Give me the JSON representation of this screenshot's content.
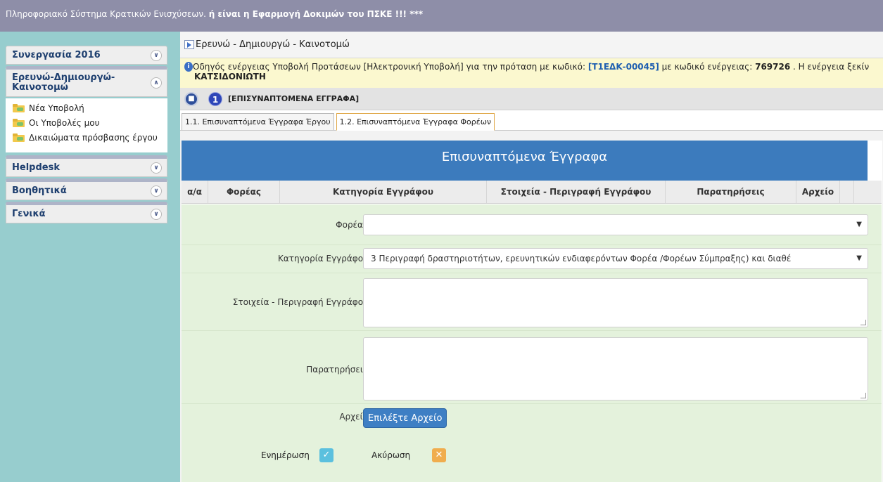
{
  "topbar": {
    "prefix": "Πληροφοριακό Σύστημα Κρατικών Ενισχύσεων. ",
    "bold": "ή είναι η Εφαρμογή Δοκιμών του ΠΣΚΕ !!! ***"
  },
  "sidebar": {
    "sections": [
      {
        "label": "Συνεργασία 2016"
      },
      {
        "label": "Ερευνώ-Δημιουργώ-Καινοτομώ"
      },
      {
        "label": "Helpdesk"
      },
      {
        "label": "Βοηθητικά"
      },
      {
        "label": "Γενικά"
      }
    ],
    "items": [
      {
        "label": "Νέα Υποβολή"
      },
      {
        "label": "Οι Υποβολές μου"
      },
      {
        "label": "Δικαιώματα πρόσβασης έργου"
      }
    ]
  },
  "breadcrumb": {
    "label": "Ερευνώ - Δημιουργώ - Καινοτομώ"
  },
  "info": {
    "t1": "Οδηγός ενέργειας Υποβολή Προτάσεων [Ηλεκτρονική Υποβολή] για την πρόταση με κωδικό: ",
    "code": "[Τ1ΕΔΚ-00045]",
    "t2": " με κωδικό ενέργειας: ",
    "action_code": "769726",
    "t3": " . Η ενέργεια ξεκίν",
    "line2": "ΚΑΤΣΙΔΟΝΙΩΤΗ"
  },
  "step": {
    "number": "1",
    "title": "[ΕΠΙΣΥΝΑΠΤΟΜΕΝΑ ΕΓΓΡΑΦΑ]"
  },
  "tabs": [
    {
      "label": "1.1. Επισυναπτόμενα Έγγραφα Έργου"
    },
    {
      "label": "1.2. Επισυναπτόμενα Έγγραφα Φορέων"
    }
  ],
  "panel": {
    "title": "Επισυναπτόμενα Έγγραφα"
  },
  "table": {
    "headers": [
      "α/α",
      "Φορέας",
      "Κατηγορία Εγγράφου",
      "Στοιχεία - Περιγραφή Εγγράφου",
      "Παρατηρήσεις",
      "Αρχείο"
    ]
  },
  "form": {
    "foreas_label": "Φορέας",
    "foreas_value": "",
    "category_label": "Κατηγορία Εγγράφου",
    "category_value": "3 Περιγραφή δραστηριοτήτων, ερευνητικών ενδιαφερόντων Φορέα /Φορέων Σύμπραξης) και διαθέ",
    "details_label": "Στοιχεία - Περιγραφή Εγγράφου",
    "notes_label": "Παρατηρήσεις",
    "file_label": "Αρχείο",
    "file_button": "Επιλέξτε Αρχείο",
    "update_label": "Ενημέρωση",
    "cancel_label": "Ακύρωση"
  },
  "colors": {
    "update": "#5bc0de",
    "cancel": "#f0ad4e",
    "banner": "#3c7bbd"
  }
}
